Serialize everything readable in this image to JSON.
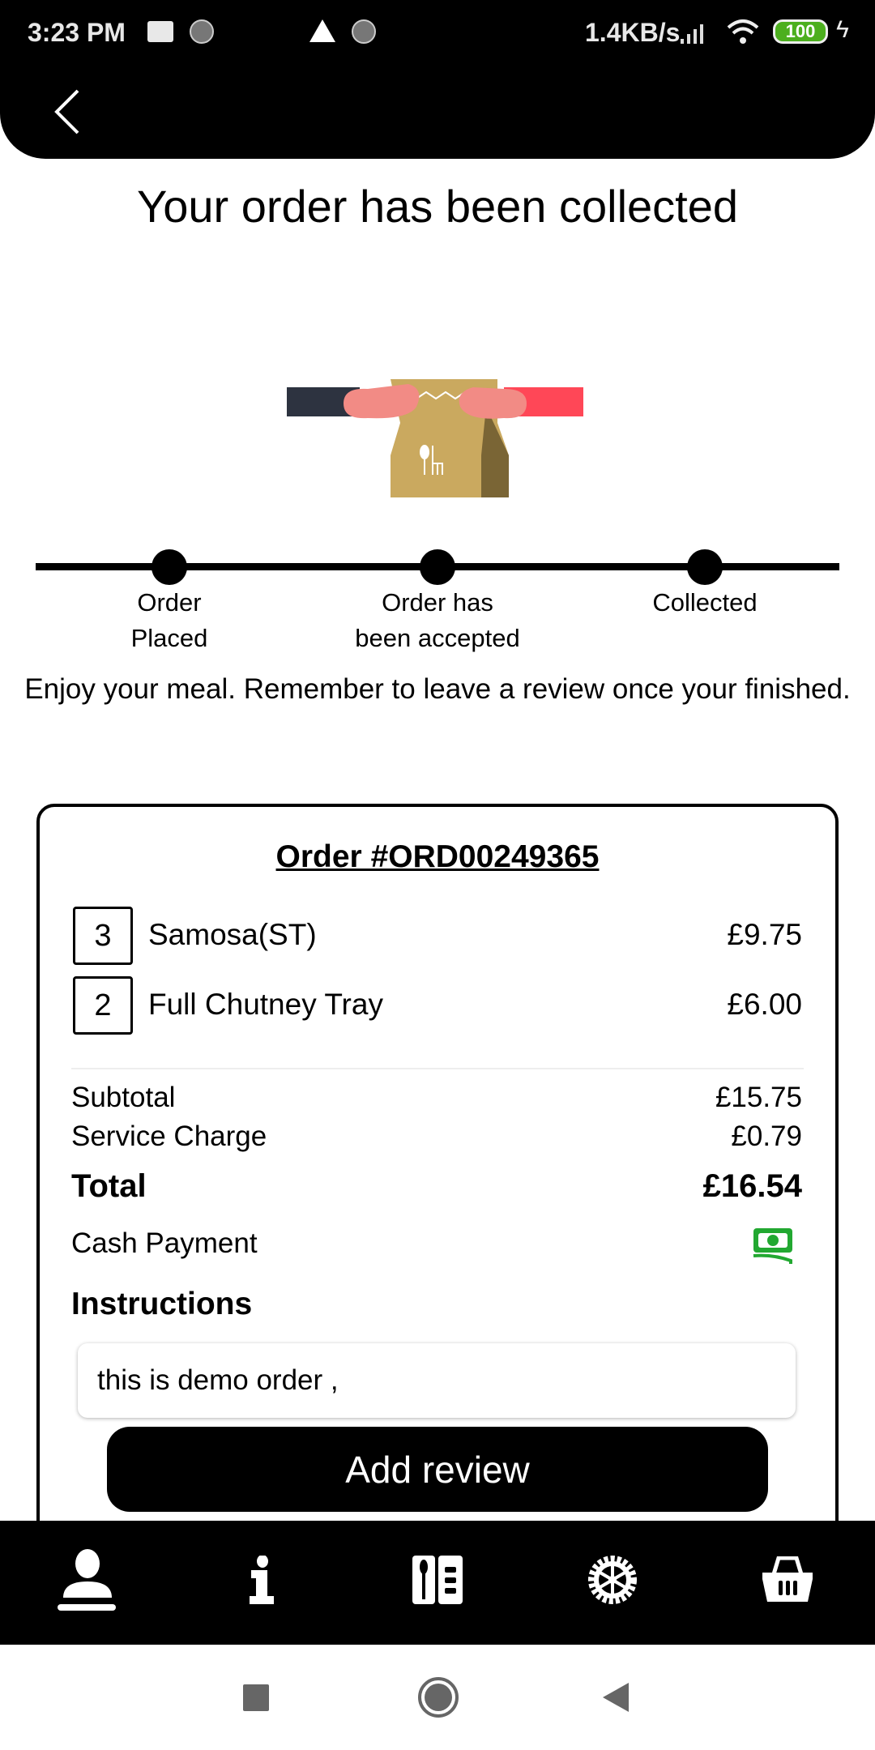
{
  "status_bar": {
    "time": "3:23 PM",
    "network_speed": "1.4KB/s",
    "battery": "100",
    "battery_color": "#4caf1e"
  },
  "header": {
    "back_icon": "chevron-left-icon"
  },
  "title": "Your order has been collected",
  "progress": {
    "steps": [
      {
        "label_line1": "Order",
        "label_line2": "Placed"
      },
      {
        "label_line1": "Order has",
        "label_line2": "been accepted"
      },
      {
        "label_line1": "Collected",
        "label_line2": ""
      }
    ],
    "completed_steps": 3
  },
  "message": "Enjoy your meal. Remember to leave a review once your finished.",
  "order": {
    "title": "Order #ORD00249365",
    "items": [
      {
        "qty": "3",
        "name": "Samosa(ST)",
        "price": "£9.75"
      },
      {
        "qty": "2",
        "name": "Full Chutney Tray",
        "price": "£6.00"
      }
    ],
    "subtotal_label": "Subtotal",
    "subtotal": "£15.75",
    "service_label": "Service Charge",
    "service": "£0.79",
    "total_label": "Total",
    "total": "£16.54",
    "payment_label": "Cash Payment",
    "payment_icon": "cash-icon",
    "payment_color": "#22a831",
    "instructions_label": "Instructions",
    "instructions": "this is demo order ,",
    "review_button": "Add review"
  },
  "bottom_nav": {
    "items": [
      "profile-icon",
      "info-icon",
      "menu-icon",
      "settings-icon",
      "basket-icon"
    ]
  }
}
